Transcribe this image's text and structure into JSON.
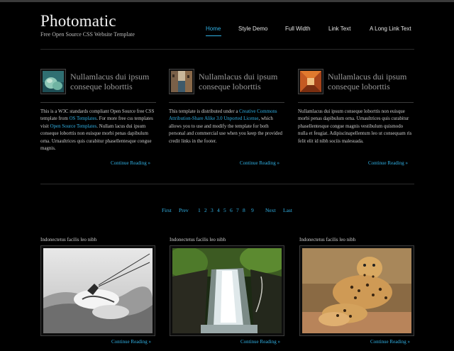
{
  "site": {
    "title": "Photomatic",
    "tagline": "Free Open Source CSS Website Template"
  },
  "nav": [
    {
      "label": "Home",
      "active": true
    },
    {
      "label": "Style Demo"
    },
    {
      "label": "Full Width"
    },
    {
      "label": "Link Text"
    },
    {
      "label": "A Long Link Text"
    }
  ],
  "featured": [
    {
      "thumb_icon": "dolphin-thumbnail-icon",
      "title": "Nullamlacus dui ipsum conseque loborttis",
      "text": [
        {
          "t": "This is a W3C standards compliant Open Source free CSS template from "
        },
        {
          "t": "OS Templates",
          "link": true
        },
        {
          "t": ". For more free css templates visit "
        },
        {
          "t": "Open Source Templates",
          "link": true
        },
        {
          "t": ". Nullam lacus dui ipsum conseque loborttis non euisque morbi penas dapibulum orna. Urnaultrices quis curabitur phasellentesque congue magnis."
        }
      ],
      "more": "Continue Reading »"
    },
    {
      "thumb_icon": "canal-thumbnail-icon",
      "title": "Nullamlacus dui ipsum conseque loborttis",
      "text": [
        {
          "t": "This template is distributed under a "
        },
        {
          "t": "Creative Commons Attribution-Share Alike 3.0 Unported License",
          "link": true
        },
        {
          "t": ", which allows you to use and modify the template for both personal and commercial use when you keep the provided credit links in the footer."
        }
      ],
      "more": "Continue Reading »"
    },
    {
      "thumb_icon": "corridor-thumbnail-icon",
      "title": "Nullamlacus dui ipsum conseque loborttis",
      "text": [
        {
          "t": "Nullamlacus dui ipsum conseque loborttis non euisque morbi penas dapibulum orna. Urnaultrices quis curabitur phasellentesque congue magnis vestibulum quismodo nulla et feugiat. Adipiscinapellentum leo ut consequam ris felit elit id nibh sociis malesuada."
        }
      ],
      "more": "Continue Reading »"
    }
  ],
  "pagination": {
    "first": "First",
    "prev": "Prev",
    "pages": [
      "1",
      "2",
      "3",
      "4",
      "5",
      "6",
      "7",
      "8",
      "9"
    ],
    "next": "Next",
    "last": "Last"
  },
  "gallery": [
    {
      "caption": "Indonectetus facilis leo nibh",
      "image": "kitesurfer-photo-icon",
      "more": "Continue Reading »"
    },
    {
      "caption": "Indonectetus facilis leo nibh",
      "image": "waterfall-photo-icon",
      "more": "Continue Reading »"
    },
    {
      "caption": "Indonectetus facilis leo nibh",
      "image": "leopard-photo-icon",
      "more": "Continue Reading »"
    }
  ],
  "colors": {
    "background": "#000000",
    "link": "#31b2e6",
    "heading": "#999999",
    "text": "#cfcfcf"
  }
}
